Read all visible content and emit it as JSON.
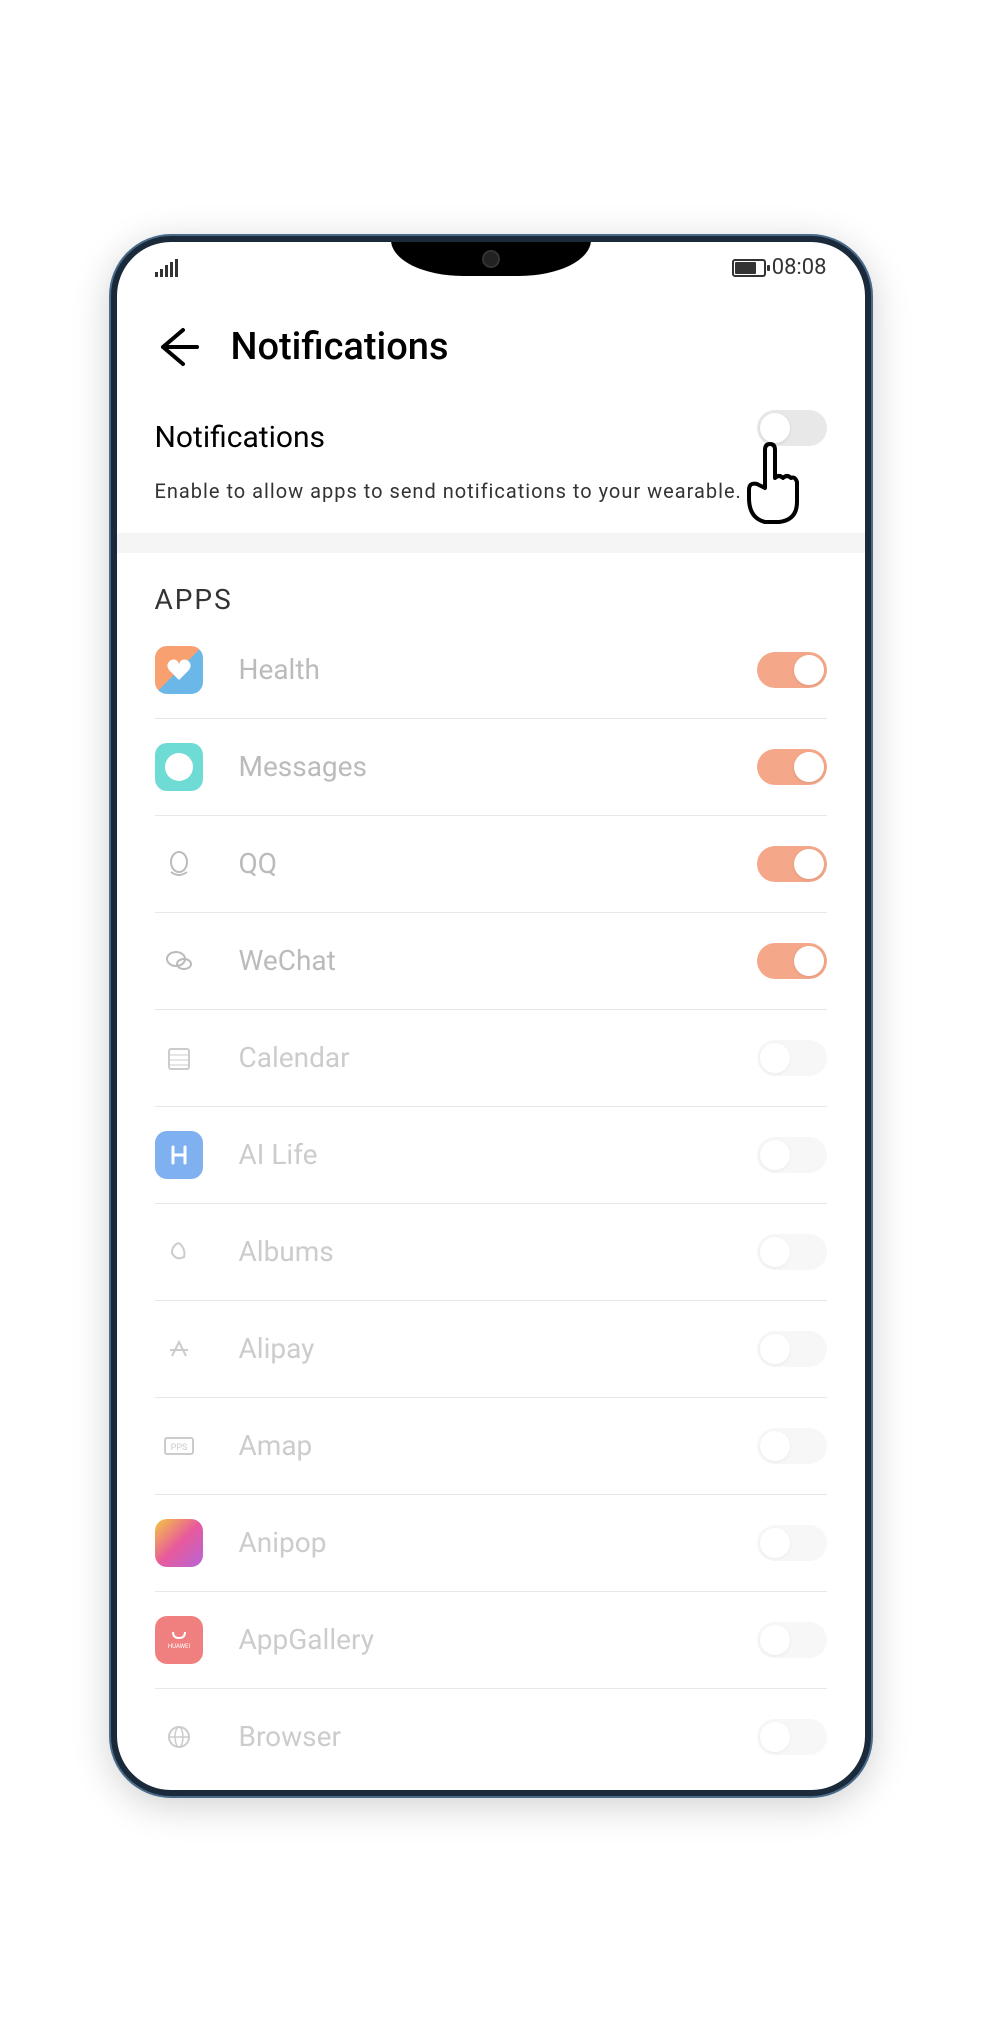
{
  "status": {
    "time": "08:08"
  },
  "header": {
    "title": "Notifications"
  },
  "master": {
    "title": "Notifications",
    "description": "Enable to allow apps to send notifications to your wearable.",
    "enabled": false
  },
  "sections": {
    "apps_label": "APPS"
  },
  "apps": [
    {
      "name": "Health",
      "icon": "health-icon",
      "enabled": true
    },
    {
      "name": "Messages",
      "icon": "messages-icon",
      "enabled": true
    },
    {
      "name": "QQ",
      "icon": "qq-icon",
      "enabled": true
    },
    {
      "name": "WeChat",
      "icon": "wechat-icon",
      "enabled": true
    },
    {
      "name": "Calendar",
      "icon": "calendar-icon",
      "enabled": false
    },
    {
      "name": "AI Life",
      "icon": "ailife-icon",
      "enabled": false
    },
    {
      "name": "Albums",
      "icon": "albums-icon",
      "enabled": false
    },
    {
      "name": "Alipay",
      "icon": "alipay-icon",
      "enabled": false
    },
    {
      "name": "Amap",
      "icon": "amap-icon",
      "enabled": false
    },
    {
      "name": "Anipop",
      "icon": "anipop-icon",
      "enabled": false
    },
    {
      "name": "AppGallery",
      "icon": "appgallery-icon",
      "enabled": false
    },
    {
      "name": "Browser",
      "icon": "browser-icon",
      "enabled": false
    }
  ],
  "colors": {
    "accent": "#f5a889",
    "toggle_off": "#e8e8e8"
  }
}
